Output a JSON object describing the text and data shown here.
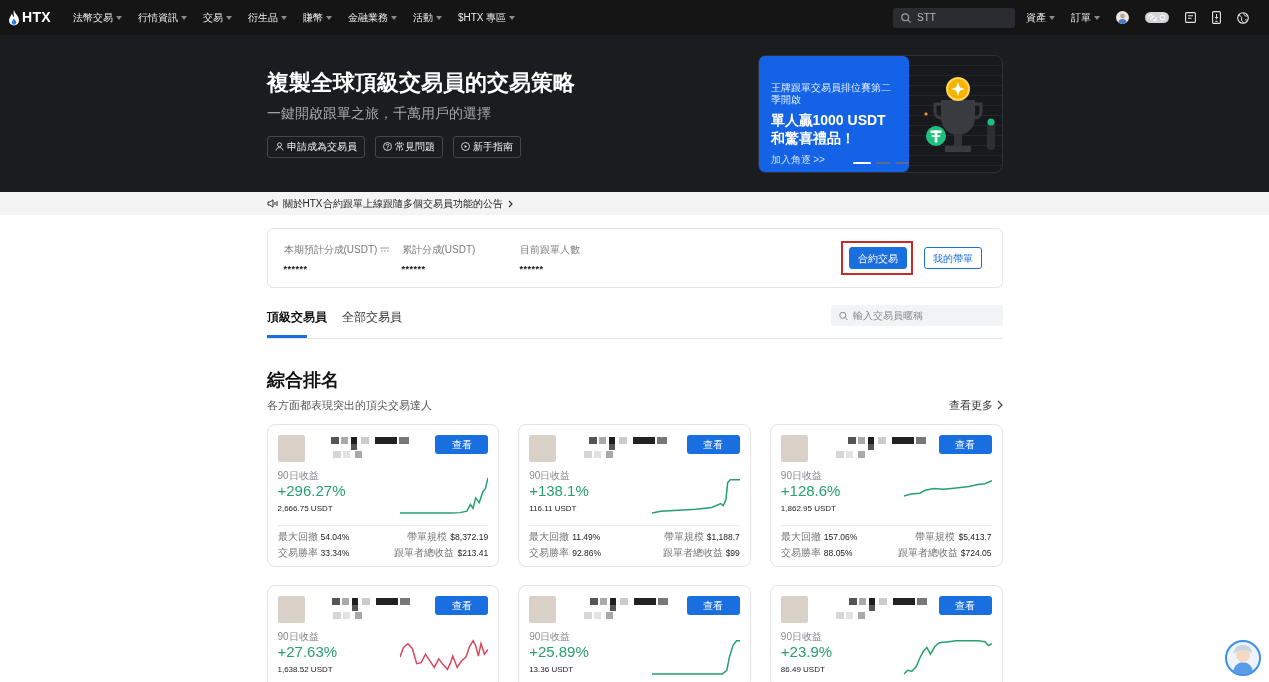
{
  "nav": {
    "logo": "HTX",
    "menu": [
      "法幣交易",
      "行情資訊",
      "交易",
      "衍生品",
      "賺幣",
      "金融業務",
      "活動",
      "$HTX 專區"
    ],
    "search": {
      "value": "STT"
    },
    "account_menu": [
      "資產",
      "訂單"
    ]
  },
  "hero": {
    "title": "複製全球頂級交易員的交易策略",
    "subtitle": "一鍵開啟跟單之旅，千萬用戶的選擇",
    "buttons": [
      {
        "label": "申請成為交易員",
        "kind": "person"
      },
      {
        "label": "常見問題",
        "kind": "question"
      },
      {
        "label": "新手指南",
        "kind": "play"
      }
    ],
    "banner": {
      "kicker": "王牌跟單交易員排位賽第二季開啟",
      "headline": "單人贏1000 USDT\n和驚喜禮品！",
      "link": "加入角逐 >>",
      "slides": [
        {
          "selected": true
        },
        {
          "selected": false
        },
        {
          "selected": false
        }
      ]
    }
  },
  "announcement": {
    "text": "關於HTX合約跟單上線跟隨多個交易員功能的公告"
  },
  "stats_panel": {
    "stats": [
      {
        "label": "本期預計分成(USDT)",
        "value": "******",
        "info": true
      },
      {
        "label": "累計分成(USDT)",
        "value": "******",
        "info": false
      },
      {
        "label": "目前跟單人數",
        "value": "******",
        "info": false
      }
    ],
    "actions": [
      {
        "label": "合約交易",
        "kind": "primary",
        "highlighted": true
      },
      {
        "label": "我的帶單",
        "kind": "outline",
        "highlighted": false
      }
    ]
  },
  "tabs": [
    {
      "label": "頂級交易員",
      "selected": true
    },
    {
      "label": "全部交易員",
      "selected": false
    }
  ],
  "trader_search": {
    "placeholder": "輸入交易員暱稱"
  },
  "ranking": {
    "title": "綜合排名",
    "subtitle": "各方面都表現突出的頂尖交易達人",
    "more": "查看更多"
  },
  "traders": [
    {
      "action": "查看",
      "period_label": "90日收益",
      "return": "+296.27%",
      "profit": "2,666.75 USDT",
      "color": "#26a06d",
      "stats": [
        {
          "label": "最大回撤",
          "value": "54.04%"
        },
        {
          "label": "帶單規模",
          "value": "$8,372.19"
        },
        {
          "label": "交易勝率",
          "value": "33.34%"
        },
        {
          "label": "跟單者總收益",
          "value": "$213.41"
        }
      ]
    },
    {
      "action": "查看",
      "period_label": "90日收益",
      "return": "+138.1%",
      "profit": "116.11 USDT",
      "color": "#26a06d",
      "stats": [
        {
          "label": "最大回撤",
          "value": "11.49%"
        },
        {
          "label": "帶單規模",
          "value": "$1,188.7"
        },
        {
          "label": "交易勝率",
          "value": "92.86%"
        },
        {
          "label": "跟單者總收益",
          "value": "$99"
        }
      ]
    },
    {
      "action": "查看",
      "period_label": "90日收益",
      "return": "+128.6%",
      "profit": "1,862.95 USDT",
      "color": "#26a06d",
      "stats": [
        {
          "label": "最大回撤",
          "value": "157.06%"
        },
        {
          "label": "帶單規模",
          "value": "$5,413.7"
        },
        {
          "label": "交易勝率",
          "value": "88.05%"
        },
        {
          "label": "跟單者總收益",
          "value": "$724.05"
        }
      ]
    },
    {
      "action": "查看",
      "period_label": "90日收益",
      "return": "+27.63%",
      "profit": "1,638.52 USDT",
      "color": "#d9485f"
    },
    {
      "action": "查看",
      "period_label": "90日收益",
      "return": "+25.89%",
      "profit": "13.36 USDT",
      "color": "#26a06d"
    },
    {
      "action": "查看",
      "period_label": "90日收益",
      "return": "+23.9%",
      "profit": "86.49 USDT",
      "color": "#26a06d"
    }
  ]
}
